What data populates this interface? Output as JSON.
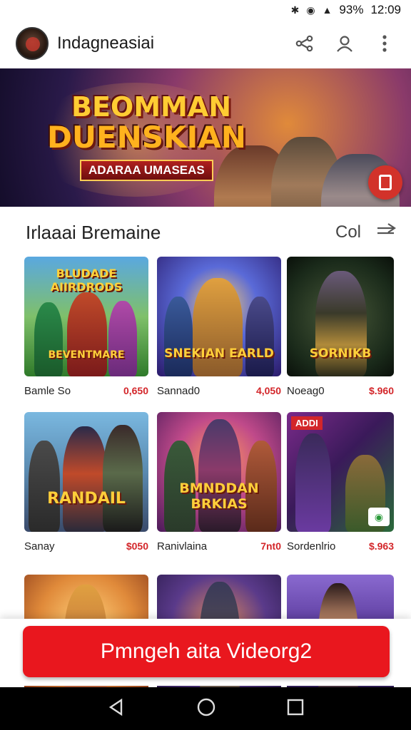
{
  "statusbar": {
    "battery": "93%",
    "time": "12:09"
  },
  "appbar": {
    "title": "Indagneasiai"
  },
  "banner": {
    "title_line1": "BEOMMAN",
    "title_line2": "DUENSKIAN",
    "subtitle": "ADARAA UMASEAS"
  },
  "section": {
    "title": "Irlaaai Bremaine",
    "more": "Col"
  },
  "cards": [
    {
      "name": "Bamle So",
      "price": "0,650",
      "art_text": "BLUDADE AIIRDRODS",
      "art_sub": "BEVENTMARE"
    },
    {
      "name": "Sannad0",
      "price": "4,050",
      "art_text": "SNEKIAN EARLD",
      "art_sub": ""
    },
    {
      "name": "Noeag0",
      "price": "$.960",
      "art_text": "SORNIKB",
      "art_sub": ""
    },
    {
      "name": "Sanay",
      "price": "$050",
      "art_text": "RANDAIL",
      "art_sub": ""
    },
    {
      "name": "Ranivlaina",
      "price": "7nt0",
      "art_text": "BMNDDAN BRKIAS",
      "art_sub": ""
    },
    {
      "name": "Sordenlrio",
      "price": "$.963",
      "art_text": "",
      "badge": "ADDI"
    },
    {
      "name": "",
      "price": "",
      "art_text": ""
    },
    {
      "name": "",
      "price": "",
      "art_text": ""
    },
    {
      "name": "",
      "price": "",
      "art_text": ""
    }
  ],
  "cta": {
    "label": "Pmngeh aita Videorg2"
  }
}
